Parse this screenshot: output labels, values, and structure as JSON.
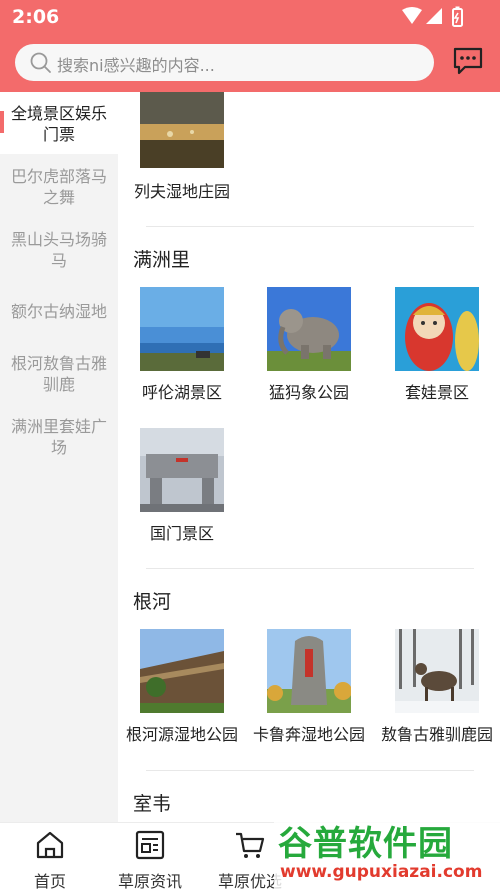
{
  "status_bar": {
    "time": "2:06"
  },
  "search": {
    "placeholder": "搜索ni感兴趣的内容..."
  },
  "sidebar": {
    "items": [
      {
        "label": "全境景区娱乐门票",
        "active": true
      },
      {
        "label": "巴尔虎部落马之舞",
        "active": false
      },
      {
        "label": "黑山头马场骑马",
        "active": false
      },
      {
        "label": "额尔古纳湿地",
        "active": false
      },
      {
        "label": "根河敖鲁古雅驯鹿",
        "active": false
      },
      {
        "label": "满洲里套娃广场",
        "active": false
      }
    ]
  },
  "content": {
    "top_item": {
      "label": "列夫湿地庄园"
    },
    "sections": [
      {
        "title": "满洲里",
        "items": [
          {
            "label": "呼伦湖景区"
          },
          {
            "label": "猛犸象公园"
          },
          {
            "label": "套娃景区"
          },
          {
            "label": "国门景区"
          }
        ]
      },
      {
        "title": "根河",
        "items": [
          {
            "label": "根河源湿地公园"
          },
          {
            "label": "卡鲁奔湿地公园"
          },
          {
            "label": "敖鲁古雅驯鹿园"
          }
        ]
      },
      {
        "title": "室韦",
        "items": []
      }
    ]
  },
  "tabbar": {
    "tabs": [
      {
        "label": "首页",
        "icon": "home-icon"
      },
      {
        "label": "草原资讯",
        "icon": "news-icon"
      },
      {
        "label": "草原优选",
        "icon": "cart-icon"
      }
    ]
  },
  "watermark": {
    "title": "谷普软件园",
    "url": "www.gupuxiazai.com"
  },
  "colors": {
    "accent": "#f36b6b",
    "watermark_green": "#26a93c",
    "watermark_red": "#e23b2e"
  }
}
